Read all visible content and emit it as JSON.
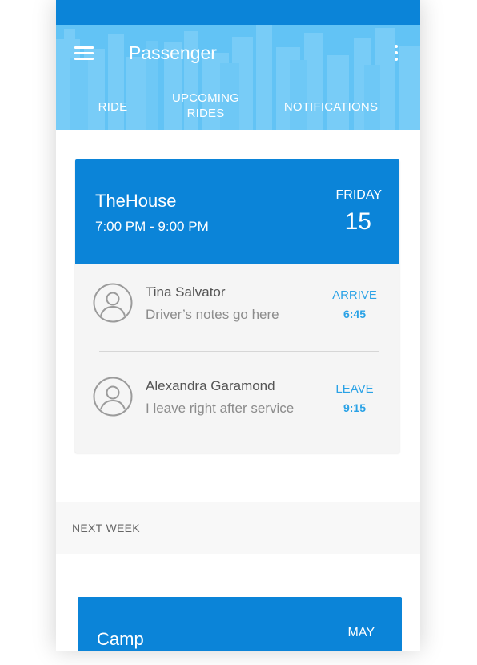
{
  "colors": {
    "status_bar": "#0b84d8",
    "app_bar": "#62c3f5",
    "card_header": "#0b84d8",
    "accent_text": "#2aa2e6"
  },
  "app_bar": {
    "title": "Passenger",
    "menu_icon": "hamburger-menu-icon",
    "more_icon": "more-vertical-icon"
  },
  "tabs": [
    {
      "label": "RIDE"
    },
    {
      "label_line1": "UPCOMING",
      "label_line2": "RIDES",
      "selected": true
    },
    {
      "label": "NOTIFICATIONS"
    }
  ],
  "event": {
    "name": "TheHouse",
    "time": "7:00 PM - 9:00 PM",
    "day": "FRIDAY",
    "date": "15",
    "riders": [
      {
        "name": "Tina Salvator",
        "note": "Driver’s notes go here",
        "action": "ARRIVE",
        "time": "6:45",
        "avatar_icon": "user-avatar-icon"
      },
      {
        "name": "Alexandra Garamond",
        "note": "I leave right after service",
        "action": "LEAVE",
        "time": "9:15",
        "avatar_icon": "user-avatar-icon"
      }
    ]
  },
  "section": {
    "label": "NEXT WEEK"
  },
  "event2": {
    "name": "Camp",
    "month": "MAY"
  }
}
